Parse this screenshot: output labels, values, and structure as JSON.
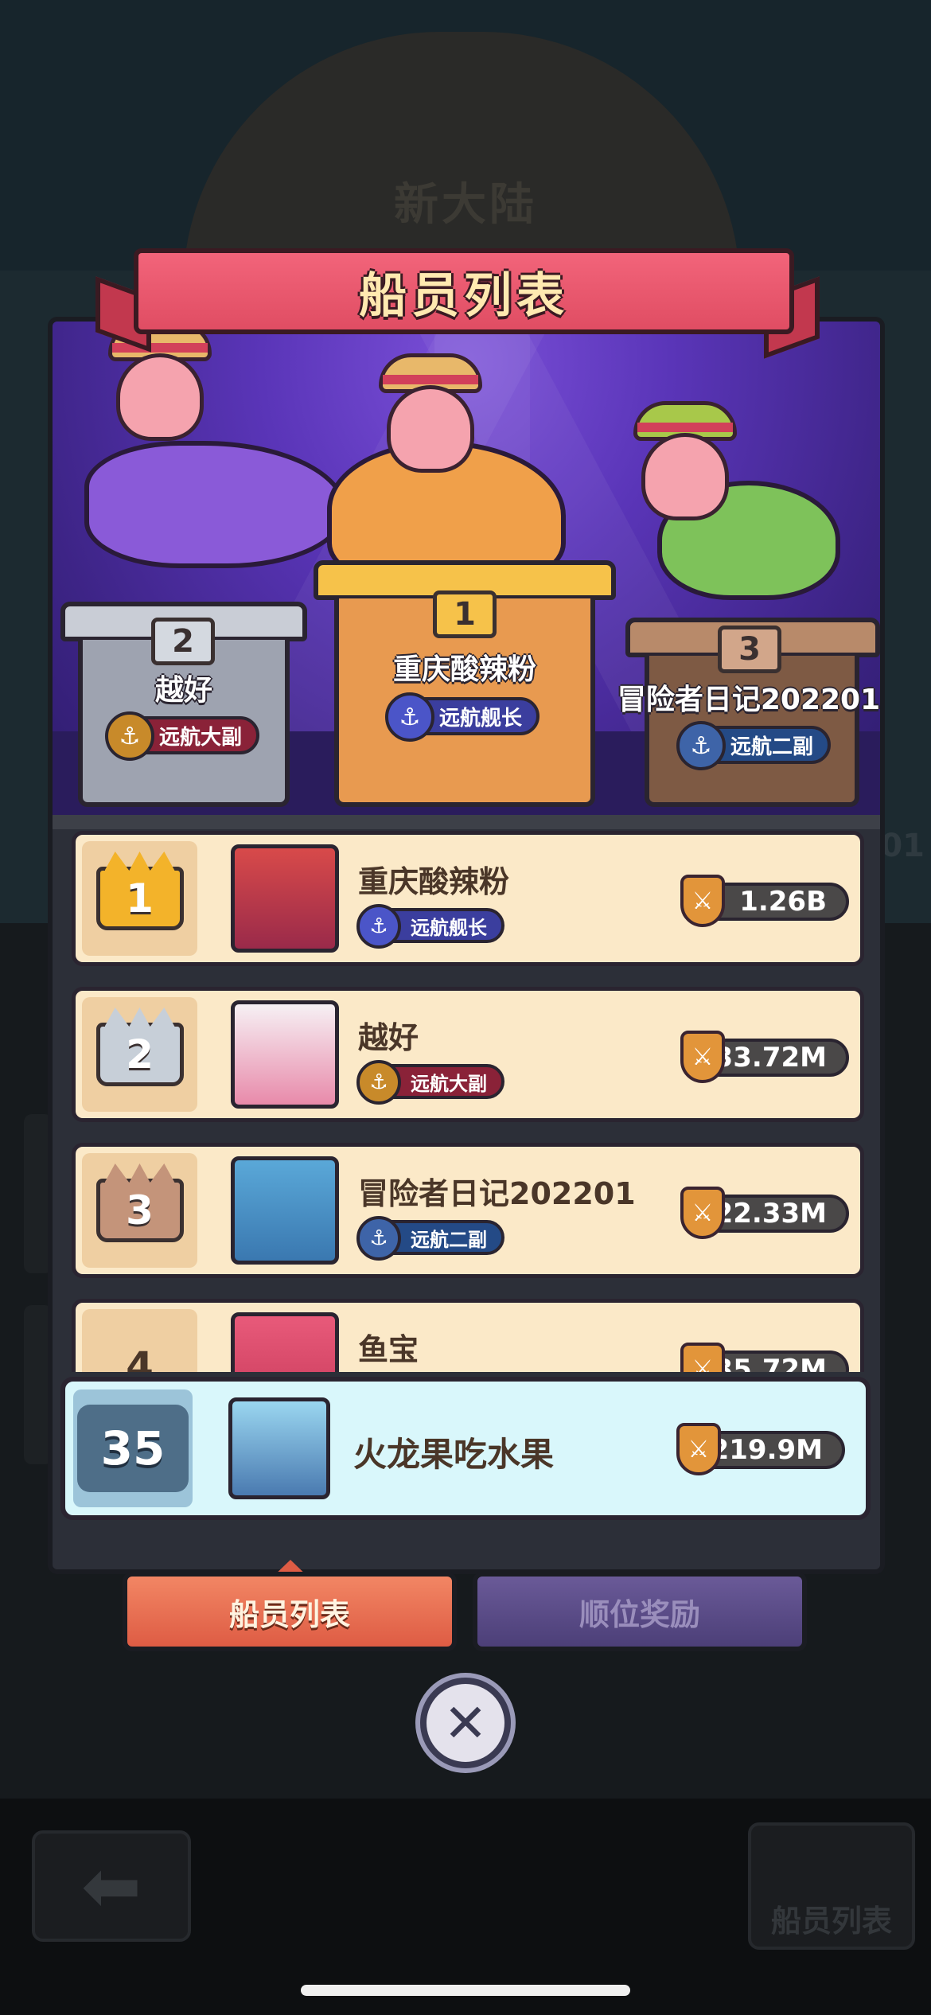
{
  "background": {
    "map_title": "新大陆",
    "side_number": "01",
    "crew_button_label": "船员列表"
  },
  "dialog": {
    "title": "船员列表"
  },
  "podium": [
    {
      "place": "2",
      "name": "越好",
      "title": "远航大副"
    },
    {
      "place": "1",
      "name": "重庆酸辣粉",
      "title": "远航舰长"
    },
    {
      "place": "3",
      "name": "冒险者日记202201",
      "title": "远航二副"
    }
  ],
  "ranking": [
    {
      "rank": "1",
      "name": "重庆酸辣粉",
      "title": "远航舰长",
      "power": "1.26B"
    },
    {
      "rank": "2",
      "name": "越好",
      "title": "远航大副",
      "power": "533.72M"
    },
    {
      "rank": "3",
      "name": "冒险者日记202201",
      "title": "远航二副",
      "power": "622.33M"
    },
    {
      "rank": "4",
      "name": "鱼宝",
      "title": "",
      "power": "535.72M"
    }
  ],
  "me": {
    "rank": "35",
    "name": "火龙果吃水果",
    "power": "219.9M"
  },
  "tabs": {
    "crew_list": "船员列表",
    "rank_rewards": "顺位奖励"
  },
  "colors": {
    "accent": "#de5c44",
    "banner": "#e04d63",
    "podium_bg": "#5a35b8",
    "row_bg": "#fbe9c8",
    "my_row_bg": "#d9f7fb"
  }
}
